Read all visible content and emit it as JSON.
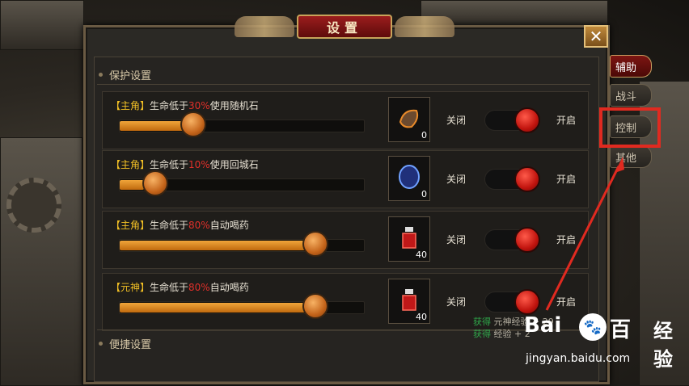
{
  "dialog": {
    "title": "设置",
    "close_glyph": "✕"
  },
  "sections": {
    "protection": "保护设置",
    "shortcut": "便捷设置"
  },
  "rows": [
    {
      "role": "【主角】",
      "prefix": "生命低于",
      "percent": "30%",
      "action": "使用随机石",
      "slider_value": 0.3,
      "item_icon": "random-stone-icon",
      "item_count": "0",
      "off_label": "关闭",
      "on_label": "开启"
    },
    {
      "role": "【主角】",
      "prefix": "生命低于",
      "percent": "10%",
      "action": "使用回城石",
      "slider_value": 0.1,
      "item_icon": "return-stone-icon",
      "item_count": "0",
      "off_label": "关闭",
      "on_label": "开启"
    },
    {
      "role": "【主角】",
      "prefix": "生命低于",
      "percent": "80%",
      "action": "自动喝药",
      "slider_value": 0.8,
      "item_icon": "potion-icon",
      "item_count": "40",
      "off_label": "关闭",
      "on_label": "开启"
    },
    {
      "role": "【元神】",
      "prefix": "生命低于",
      "percent": "80%",
      "action": "自动喝药",
      "slider_value": 0.8,
      "item_icon": "potion-icon",
      "item_count": "40",
      "off_label": "关闭",
      "on_label": "开启"
    }
  ],
  "side_tabs": [
    {
      "label": "辅助",
      "active": true
    },
    {
      "label": "战斗",
      "active": false
    },
    {
      "label": "控制",
      "active": false
    },
    {
      "label": "其他",
      "active": false
    }
  ],
  "exp_log": [
    {
      "gain": "获得",
      "text": "元神经验 + 29"
    },
    {
      "gain": "获得",
      "text": "经验 + 2"
    }
  ],
  "watermark": {
    "brand_a": "Bai",
    "brand_b": "百",
    "brand_c": "经验",
    "url": "jingyan.baidu.com"
  },
  "colors": {
    "accent_red": "#e02a20",
    "slider_orange": "#f0a53a",
    "role_yellow": "#f2c025"
  }
}
